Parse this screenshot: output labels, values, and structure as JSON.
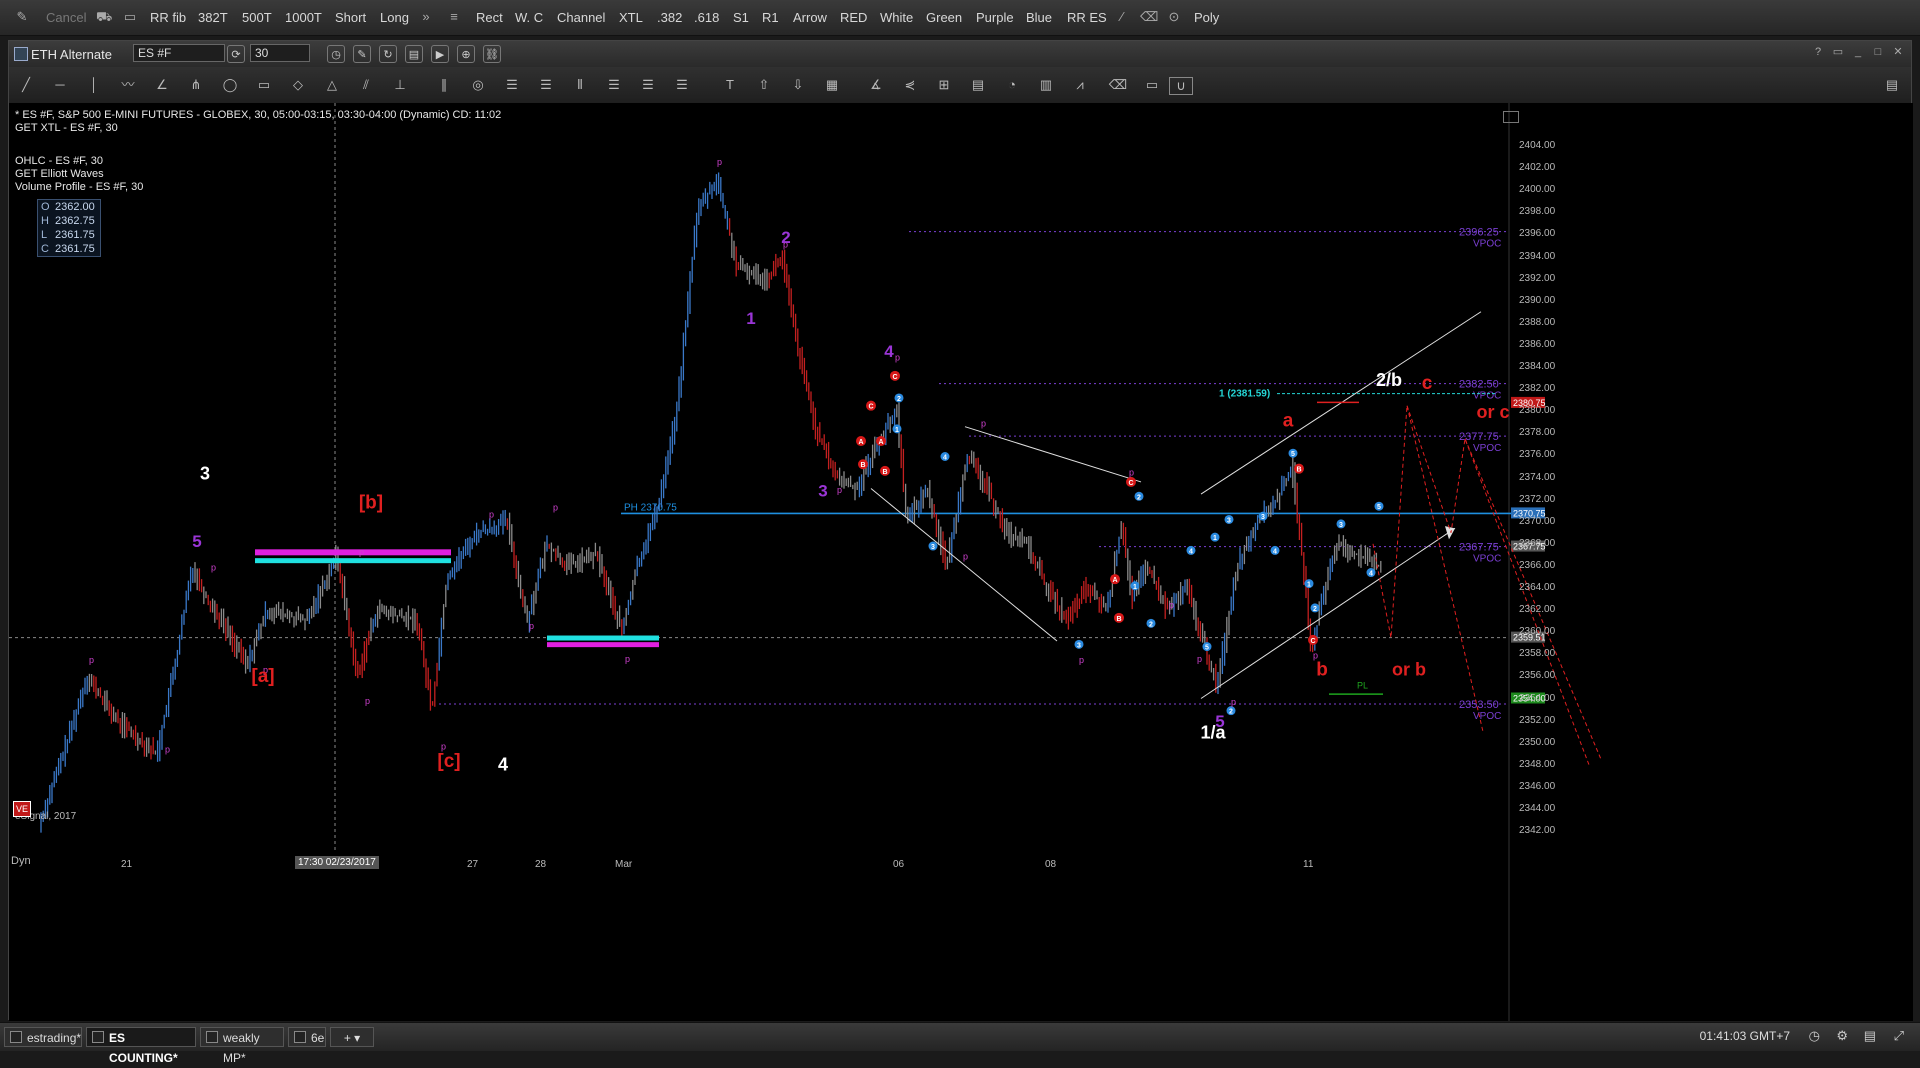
{
  "toolbar": {
    "items": [
      "Cancel",
      "RR fib",
      "382T",
      "500T",
      "1000T",
      "Short",
      "Long",
      "Rect",
      "W. C",
      "Channel",
      "XTL",
      ".382",
      ".618",
      "S1",
      "R1",
      "Arrow",
      "RED",
      "White",
      "Green",
      "Purple",
      "Blue",
      "RR ES",
      "Poly"
    ]
  },
  "window": {
    "title": "ETH Alternate",
    "symbol": "ES #F",
    "interval": "30"
  },
  "chart": {
    "info_lines": [
      "* ES #F, S&P 500 E-MINI FUTURES - GLOBEX, 30, 05:00-03:15, 03:30-04:00 (Dynamic) CD: 11:02",
      "GET XTL - ES #F, 30",
      "OHLC - ES #F, 30",
      "GET Elliott Waves",
      "Volume Profile - ES #F, 30"
    ],
    "ohlc": {
      "O": "2362.00",
      "H": "2362.75",
      "L": "2361.75",
      "C": "2361.75"
    },
    "y_axis_labels": [
      "2404.00",
      "2402.00",
      "2400.00",
      "2398.00",
      "2396.00",
      "2394.00",
      "2392.00",
      "2390.00",
      "2388.00",
      "2386.00",
      "2384.00",
      "2382.00",
      "2380.00",
      "2378.00",
      "2376.00",
      "2374.00",
      "2372.00",
      "2370.00",
      "2368.00",
      "2366.00",
      "2364.00",
      "2362.00",
      "2360.00",
      "2358.00",
      "2356.00",
      "2354.00",
      "2352.00",
      "2350.00",
      "2348.00",
      "2346.00",
      "2344.00",
      "2342.00"
    ],
    "x_axis_labels": [
      "21",
      "27",
      "28",
      "Mar",
      "06",
      "08",
      "11"
    ],
    "crosshair_time": "17:30 02/23/2017",
    "vpoc_levels": [
      {
        "price": "2396.25",
        "label": "VPOC"
      },
      {
        "price": "2382.50",
        "label": "VPOC"
      },
      {
        "price": "2377.75",
        "label": "VPOC"
      },
      {
        "price": "2367.75",
        "label": "VPOC"
      },
      {
        "price": "2353.50",
        "label": "VPOC"
      }
    ],
    "price_tags": [
      "2380.75",
      "2370.75",
      "2367.75",
      "2359.51",
      "2354.00"
    ],
    "ph_label": "PH 2370.75",
    "fib_label": "1 (2381.59)",
    "pl_label": "PL",
    "wave_labels": {
      "white": [
        "3",
        "4",
        "2/b",
        "1/a"
      ],
      "red": [
        "[b]",
        "[a]",
        "[c]",
        "a",
        "b",
        "c",
        "or c",
        "or b"
      ],
      "purple": [
        "5",
        "1",
        "2",
        "3",
        "4",
        "5"
      ]
    },
    "watermark": "eSignal, 2017",
    "dyn_label": "Dyn"
  },
  "tabs": [
    {
      "label": "estrading*",
      "active": false
    },
    {
      "label": "ES COUNTING*",
      "active": true
    },
    {
      "label": "weakly MP*",
      "active": false
    },
    {
      "label": "6e",
      "active": false
    }
  ],
  "status": {
    "clock": "01:41:03 GMT+7"
  },
  "colors": {
    "up_bar": "#3a78c8",
    "down_bar": "#c42020",
    "neutral_bar": "#8a8a8a",
    "vpoc": "#7b3fd4",
    "ph_line": "#1e8fe0",
    "accent_red": "#e8201e",
    "accent_purple": "#9a35d6"
  }
}
